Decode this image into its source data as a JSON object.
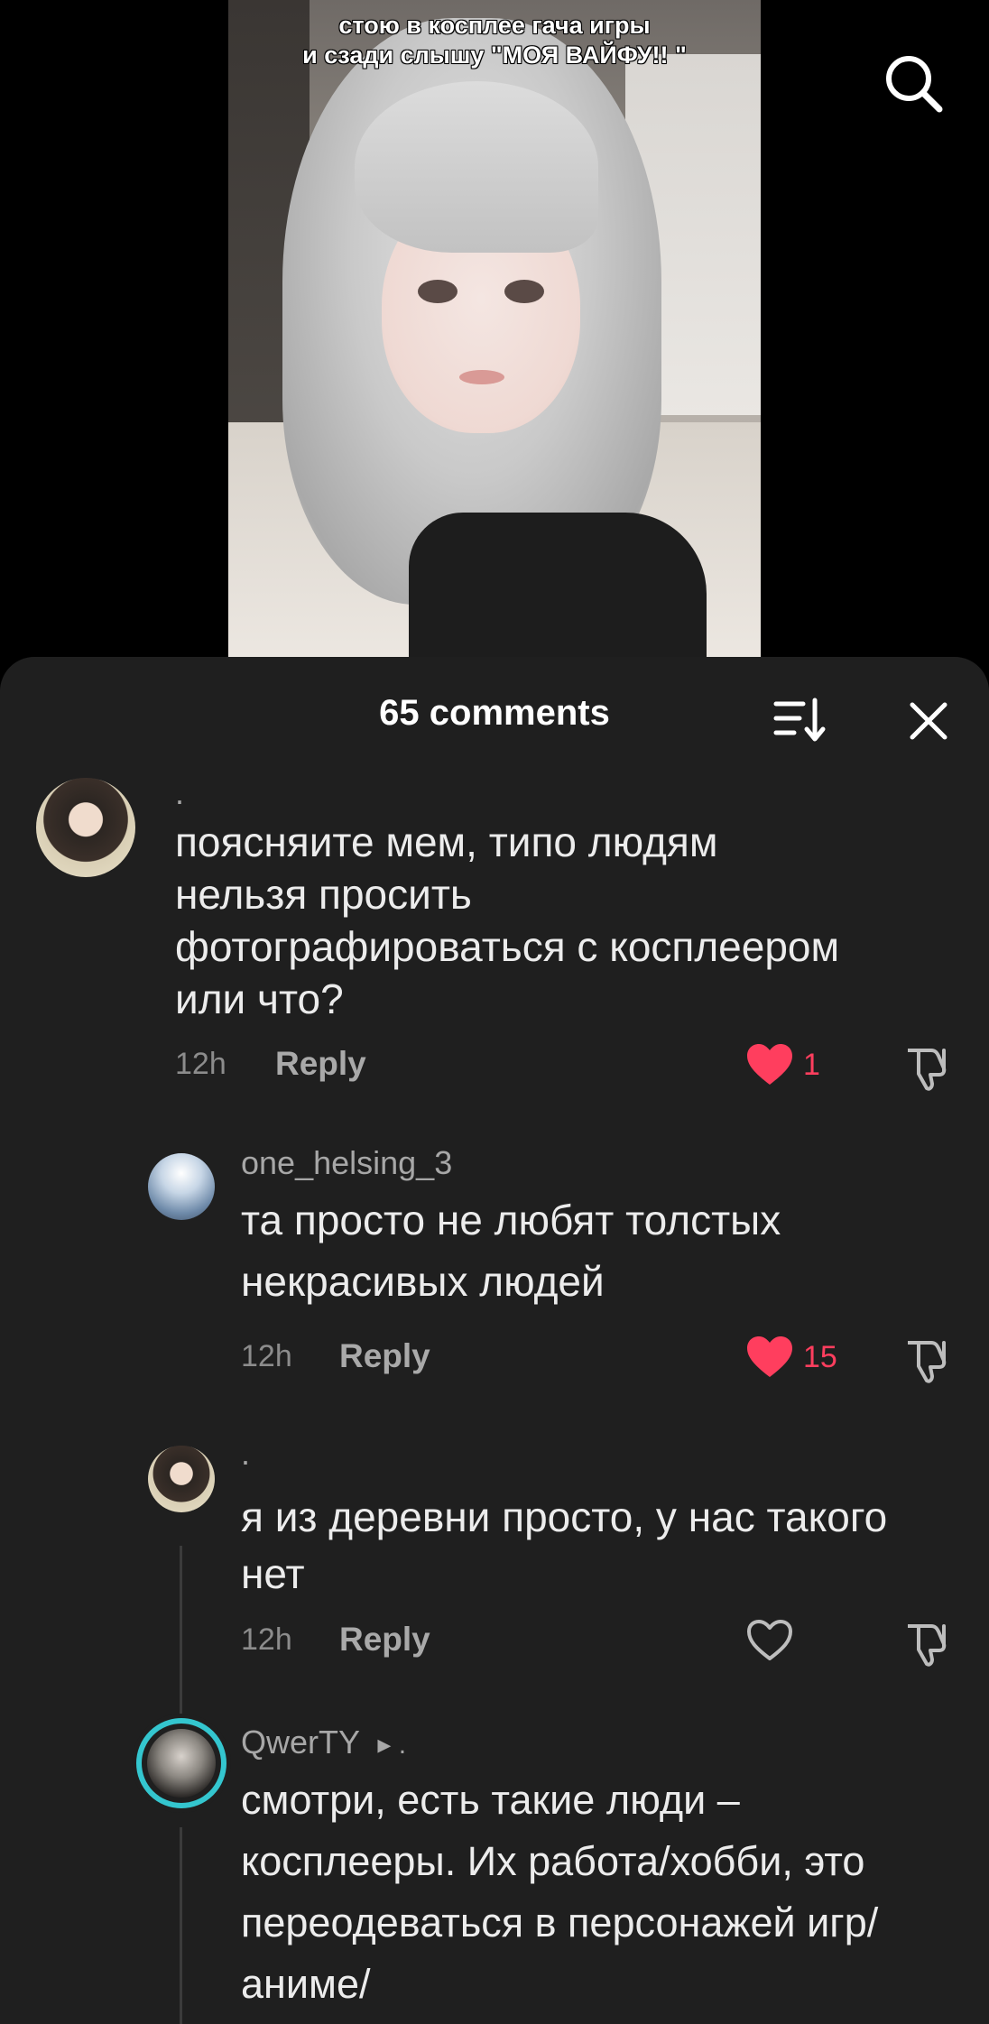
{
  "video": {
    "caption_line1": "стою в косплее гача игры",
    "caption_line2": "и сзади слышу \"МОЯ ВАЙФУ!! \"",
    "search_icon": "search-icon"
  },
  "comments_sheet": {
    "title": "65 comments",
    "sort_icon": "sort-icon",
    "close_icon": "close-icon"
  },
  "comments": [
    {
      "author": ".",
      "text": "поясняите мем, типо людям нельзя просить фотографироваться с косплеером или что?",
      "time": "12h",
      "reply_label": "Reply",
      "likes": "1",
      "liked": true
    },
    {
      "author": "one_helsing_3",
      "text": "та просто не любят толстых некрасивых людей",
      "time": "12h",
      "reply_label": "Reply",
      "likes": "15",
      "liked": true
    },
    {
      "author": ".",
      "text": "я из деревни просто, у нас такого нет",
      "time": "12h",
      "reply_label": "Reply",
      "likes": "",
      "liked": false
    },
    {
      "author": "QwerTY",
      "author_suffix": "▸ .",
      "text": "смотри, есть такие люди – косплееры. Их работа/хобби, это переодеваться в персонажей игр/аниме/"
    }
  ],
  "colors": {
    "sheet_bg": "#1f1f1f",
    "like_red": "#ff3e5e",
    "story_ring": "#34c6cf"
  }
}
